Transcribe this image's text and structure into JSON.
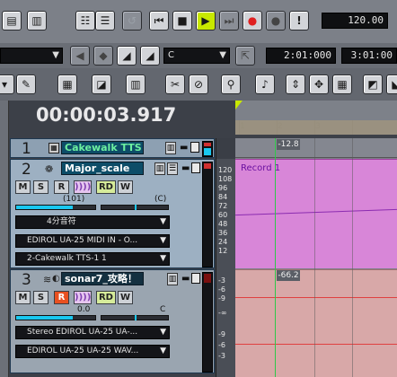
{
  "transport": {
    "tempo": "120.00",
    "exclamation": "!"
  },
  "toolbar2": {
    "snap_value": "C",
    "time_from": "2:01:000",
    "time_to": "3:01:00"
  },
  "ruler": {
    "marks": [
      "1",
      "2",
      "3"
    ]
  },
  "clock": "00:00:03.917",
  "tracks": [
    {
      "number": "1",
      "name": "Cakewalk TTS"
    },
    {
      "number": "2",
      "name": "Major_scale",
      "mute": "M",
      "solo": "S",
      "record": "R",
      "echo": "))))",
      "rd": "RD",
      "w": "W",
      "volume": "(101)",
      "pan": "(C)",
      "key": "4分音符",
      "input": "EDIROL UA-25 MIDI IN - O...",
      "output": "2-Cakewalk TTS-1 1"
    },
    {
      "number": "3",
      "name": "sonar7_攻略！",
      "mute": "M",
      "solo": "S",
      "record": "R",
      "echo": "))))",
      "rd": "RD",
      "w": "W",
      "volume": "0.0",
      "pan": "C",
      "input": "Stereo EDIROL UA-25 UA-...",
      "output": "EDIROL UA-25 UA-25 WAV..."
    }
  ],
  "clips": {
    "midi_clip_name": "Record 1",
    "marker_midi": "-12.8",
    "marker_audio": "-66.2"
  },
  "midi_scale": [
    "120",
    "108",
    "96",
    "84",
    "72",
    "60",
    "48",
    "36",
    "24",
    "12"
  ],
  "audio_scale": [
    "-3",
    "-6",
    "-9",
    "-∞",
    "-9",
    "-6",
    "-3"
  ],
  "colors": {
    "track_name_bg": "#0d4d68",
    "track_name_text": "#6df0a0",
    "midi_clip": "#d886d8",
    "audio_clip": "#d8a8a8",
    "play_button": "#c8e800",
    "record_button": "#e02020",
    "cyan_meter": "#19c8f0"
  }
}
